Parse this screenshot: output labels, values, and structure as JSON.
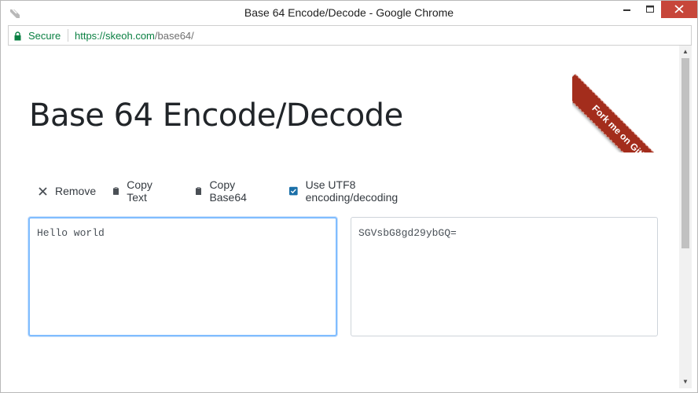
{
  "window": {
    "title": "Base 64 Encode/Decode - Google Chrome"
  },
  "address_bar": {
    "security_label": "Secure",
    "url_host": "https://skeoh.com",
    "url_path": "/base64/"
  },
  "page": {
    "heading": "Base 64 Encode/Decode",
    "ribbon_label": "Fork me on GitHub",
    "toolbar": {
      "remove_label": "Remove",
      "copy_text_label": "Copy Text",
      "copy_base64_label": "Copy Base64",
      "utf8_label": "Use UTF8 encoding/decoding",
      "utf8_checked": true
    },
    "text_input": {
      "value": "Hello world"
    },
    "base64_output": {
      "value": "SGVsbG8gd29ybGQ="
    }
  },
  "colors": {
    "accent": "#1a6fa8",
    "ribbon": "#a32d1c",
    "secure_green": "#0b8043",
    "focus_border": "#80bdff",
    "close_button": "#c7463a"
  }
}
